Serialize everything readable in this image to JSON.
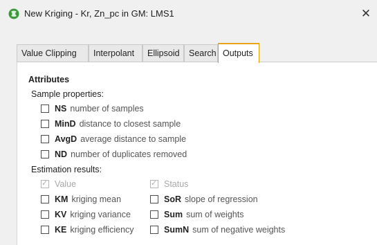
{
  "window": {
    "title": "New Kriging - Kr, Zn_pc in GM: LMS1",
    "app_icon": "geo-app-icon",
    "close_glyph": "✕"
  },
  "tabs": [
    {
      "label": "Value Clipping",
      "active": false
    },
    {
      "label": "Interpolant",
      "active": false
    },
    {
      "label": "Ellipsoid",
      "active": false
    },
    {
      "label": "Search",
      "active": false
    },
    {
      "label": "Outputs",
      "active": true
    }
  ],
  "outputs": {
    "heading": "Attributes",
    "sample_properties_label": "Sample properties:",
    "sample_properties": [
      {
        "code": "NS",
        "desc": "number of samples",
        "checked": false
      },
      {
        "code": "MinD",
        "desc": "distance to closest sample",
        "checked": false
      },
      {
        "code": "AvgD",
        "desc": "average distance to sample",
        "checked": false
      },
      {
        "code": "ND",
        "desc": "number of duplicates removed",
        "checked": false
      }
    ],
    "estimation_results_label": "Estimation results:",
    "estimation_left": [
      {
        "code": "",
        "desc": "Value",
        "checked": true,
        "disabled": true
      },
      {
        "code": "KM",
        "desc": "kriging mean",
        "checked": false
      },
      {
        "code": "KV",
        "desc": "kriging variance",
        "checked": false
      },
      {
        "code": "KE",
        "desc": "kriging efficiency",
        "checked": false
      }
    ],
    "estimation_right": [
      {
        "code": "",
        "desc": "Status",
        "checked": true,
        "disabled": true
      },
      {
        "code": "SoR",
        "desc": "slope of regression",
        "checked": false
      },
      {
        "code": "Sum",
        "desc": "sum of weights",
        "checked": false
      },
      {
        "code": "SumN",
        "desc": "sum of negative weights",
        "checked": false
      }
    ]
  },
  "colors": {
    "active_tab_accent": "#e8a317",
    "app_icon_green": "#3a9a3a"
  }
}
